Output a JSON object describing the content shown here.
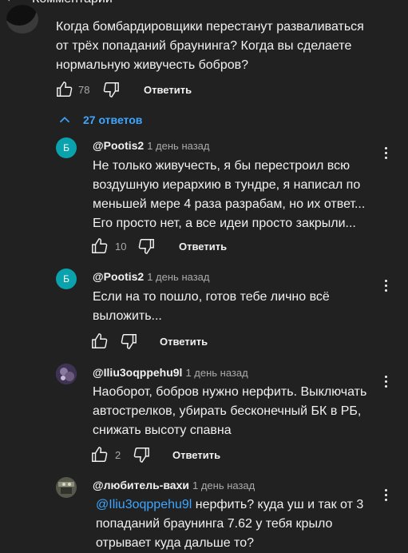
{
  "header": {
    "title": "Комментарии"
  },
  "colors": {
    "background": "#212121",
    "text": "#f1f1f1",
    "secondary": "#aaaaaa",
    "link": "#3ea6ff",
    "avatar_teal": "#0aa2ad"
  },
  "top_comment": {
    "text": "Когда бомбардировщики перестанут разваливаться\nот трёх попаданий браунинга? Когда вы сделаете\nнормальную живучесть бобров?",
    "likes": "78",
    "reply_label": "Ответить"
  },
  "replies_toggle": "27 ответов",
  "replies": [
    {
      "avatar_letter": "Б",
      "author": "@Pootis2",
      "time": "1 день назад",
      "text": "Не только живучесть, я бы перестроил всю\nвоздушную иерархию в тундре, я написал по\nменьшей мере 4 раза разрабам, но их ответ...\nЕго просто нет, а все идеи просто закрыли...",
      "likes": "10",
      "reply_label": "Ответить"
    },
    {
      "avatar_letter": "Б",
      "author": "@Pootis2",
      "time": "1 день назад",
      "text": "Если на то пошло, готов тебе лично всё\nвыложить...",
      "likes": "",
      "reply_label": "Ответить"
    },
    {
      "author": "@Iliu3oqppehu9l",
      "time": "1 день назад",
      "text": "Наоборот, бобров нужно нерфить. Выключать\nавтострелков, убирать бесконечный БК в РБ,\nснижать высоту спавна",
      "likes": "2",
      "reply_label": "Ответить"
    },
    {
      "author": "@любитель-вахи",
      "time": "1 день назад",
      "mention": "@Iliu3oqppehu9l",
      "text": " нерфить? куда уш и так от 3\nпопаданий браунинга 7.62 у тебя крыло\nотрывает куда дальше то?"
    }
  ]
}
